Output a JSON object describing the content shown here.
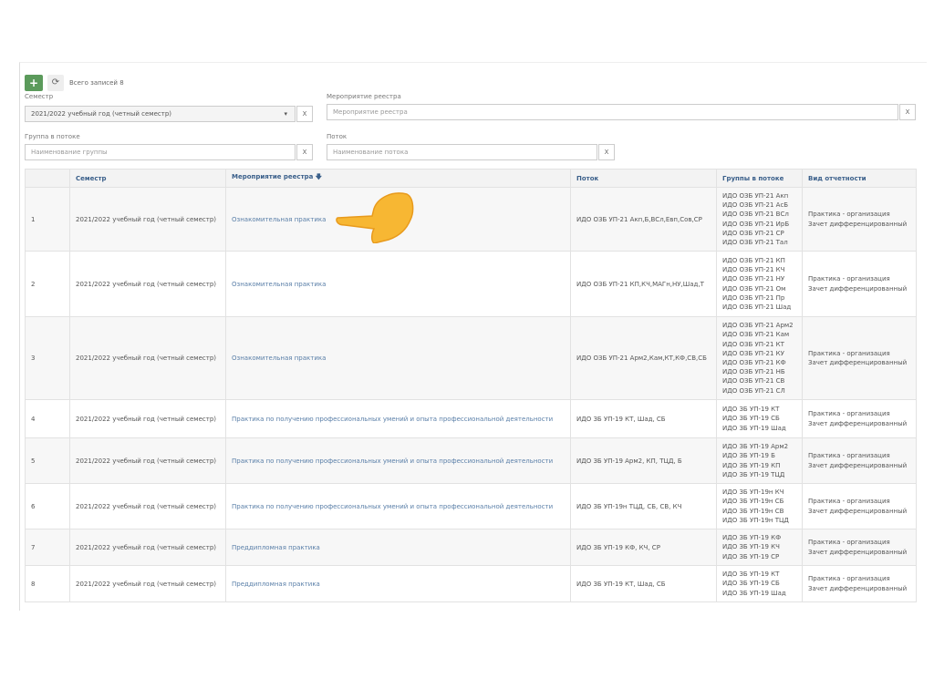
{
  "toolbar": {
    "add_label": "+",
    "refresh_label": "⟳",
    "total": "Всего записей 8"
  },
  "filters": {
    "semester_label": "Семестр",
    "semester_value": "2021/2022 учебный год (четный семестр)",
    "event_label": "Мероприятие реестра",
    "event_placeholder": "Мероприятие реестра",
    "group_label": "Группа в потоке",
    "group_placeholder": "Наименование группы",
    "stream_label": "Поток",
    "stream_placeholder": "Наименование потока",
    "clear": "X",
    "dropdown": "▾"
  },
  "table": {
    "headers": [
      "",
      "Семестр",
      "Мероприятие реестра 🡇",
      "Поток",
      "Группы в потоке",
      "Вид отчетности"
    ],
    "rows": [
      {
        "n": "1",
        "sem": "2021/2022 учебный год (четный семестр)",
        "event": "Ознакомительная практика",
        "stream": "ИДО ОЗБ УП-21 Акп,Б,ВСл,Евп,Сов,СР",
        "groups": [
          "ИДО ОЗБ УП-21 Акп",
          "ИДО ОЗБ УП-21 АсБ",
          "ИДО ОЗБ УП-21 ВСл",
          "ИДО ОЗБ УП-21 ИрБ",
          "ИДО ОЗБ УП-21 СР",
          "ИДО ОЗБ УП-21 Тал"
        ],
        "rep": [
          "Практика - организация",
          "Зачет дифференцированный"
        ]
      },
      {
        "n": "2",
        "sem": "2021/2022 учебный год (четный семестр)",
        "event": "Ознакомительная практика",
        "stream": "ИДО ОЗБ УП-21 КП,КЧ,МАГн,НУ,Шад,Т",
        "groups": [
          "ИДО ОЗБ УП-21 КП",
          "ИДО ОЗБ УП-21 КЧ",
          "ИДО ОЗБ УП-21 НУ",
          "ИДО ОЗБ УП-21 Ом",
          "ИДО ОЗБ УП-21 Пр",
          "ИДО ОЗБ УП-21 Шад"
        ],
        "rep": [
          "Практика - организация",
          "Зачет дифференцированный"
        ]
      },
      {
        "n": "3",
        "sem": "2021/2022 учебный год (четный семестр)",
        "event": "Ознакомительная практика",
        "stream": "ИДО ОЗБ УП-21 Арм2,Кам,КТ,КФ,СВ,СБ",
        "groups": [
          "ИДО ОЗБ УП-21 Арм2",
          "ИДО ОЗБ УП-21 Кам",
          "ИДО ОЗБ УП-21 КТ",
          "ИДО ОЗБ УП-21 КУ",
          "ИДО ОЗБ УП-21 КФ",
          "ИДО ОЗБ УП-21 НБ",
          "ИДО ОЗБ УП-21 СВ",
          "ИДО ОЗБ УП-21 СЛ"
        ],
        "rep": [
          "Практика - организация",
          "Зачет дифференцированный"
        ]
      },
      {
        "n": "4",
        "sem": "2021/2022 учебный год (четный семестр)",
        "event": "Практика по получению профессиональных умений и опыта профессиональной деятельности",
        "stream": "ИДО ЗБ УП-19 КТ, Шад, СБ",
        "groups": [
          "ИДО ЗБ УП-19 КТ",
          "ИДО ЗБ УП-19 СБ",
          "ИДО ЗБ УП-19 Шад"
        ],
        "rep": [
          "Практика - организация",
          "Зачет дифференцированный"
        ]
      },
      {
        "n": "5",
        "sem": "2021/2022 учебный год (четный семестр)",
        "event": "Практика по получению профессиональных умений и опыта профессиональной деятельности",
        "stream": "ИДО ЗБ УП-19 Арм2, КП, ТЦД, Б",
        "groups": [
          "ИДО ЗБ УП-19 Арм2",
          "ИДО ЗБ УП-19 Б",
          "ИДО ЗБ УП-19 КП",
          "ИДО ЗБ УП-19 ТЦД"
        ],
        "rep": [
          "Практика - организация",
          "Зачет дифференцированный"
        ]
      },
      {
        "n": "6",
        "sem": "2021/2022 учебный год (четный семестр)",
        "event": "Практика по получению профессиональных умений и опыта профессиональной деятельности",
        "stream": "ИДО ЗБ УП-19н ТЦД, СБ, СВ, КЧ",
        "groups": [
          "ИДО ЗБ УП-19н КЧ",
          "ИДО ЗБ УП-19н СБ",
          "ИДО ЗБ УП-19н СВ",
          "ИДО ЗБ УП-19н ТЦД"
        ],
        "rep": [
          "Практика - организация",
          "Зачет дифференцированный"
        ]
      },
      {
        "n": "7",
        "sem": "2021/2022 учебный год (четный семестр)",
        "event": "Преддипломная практика",
        "stream": "ИДО ЗБ УП-19 КФ, КЧ, СР",
        "groups": [
          "ИДО ЗБ УП-19 КФ",
          "ИДО ЗБ УП-19 КЧ",
          "ИДО ЗБ УП-19 СР"
        ],
        "rep": [
          "Практика - организация",
          "Зачет дифференцированный"
        ]
      },
      {
        "n": "8",
        "sem": "2021/2022 учебный год (четный семестр)",
        "event": "Преддипломная практика",
        "stream": "ИДО ЗБ УП-19 КТ, Шад, СБ",
        "groups": [
          "ИДО ЗБ УП-19 КТ",
          "ИДО ЗБ УП-19 СБ",
          "ИДО ЗБ УП-19 Шад"
        ],
        "rep": [
          "Практика - организация",
          "Зачет дифференцированный"
        ]
      }
    ]
  }
}
